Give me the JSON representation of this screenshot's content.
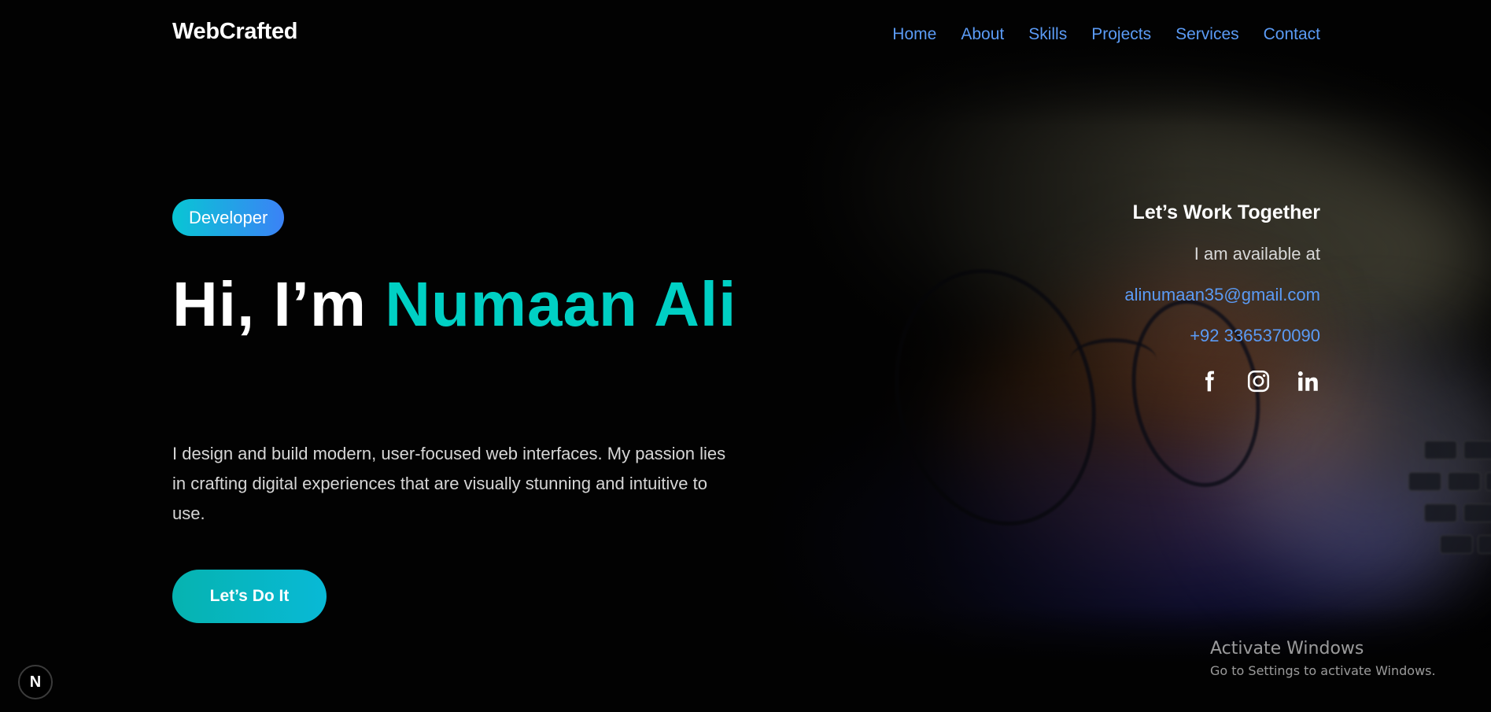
{
  "header": {
    "logo": "WebCrafted",
    "nav": [
      "Home",
      "About",
      "Skills",
      "Projects",
      "Services",
      "Contact"
    ]
  },
  "hero": {
    "badge": "Developer",
    "title_prefix": "Hi, I’m ",
    "title_name": "Numaan Ali",
    "description": "I design and build modern, user-focused web interfaces. My passion lies in crafting digital experiences that are visually stunning and intuitive to use.",
    "cta_label": "Let’s Do It"
  },
  "contact": {
    "title": "Let’s Work Together",
    "availability": "I am available at",
    "email": "alinumaan35@gmail.com",
    "phone": "+92 3365370090",
    "socials": [
      "facebook-icon",
      "instagram-icon",
      "linkedin-icon"
    ]
  },
  "dev_indicator": "N",
  "watermark": {
    "title": "Activate Windows",
    "subtitle": "Go to Settings to activate Windows."
  },
  "colors": {
    "background": "#020202",
    "accent_teal": "#00d0c4",
    "link_blue": "#5b9bf5",
    "badge_gradient_start": "#08c6d4",
    "badge_gradient_end": "#3b82f6",
    "cta_gradient_start": "#06b3b0",
    "cta_gradient_end": "#08b9d6"
  }
}
